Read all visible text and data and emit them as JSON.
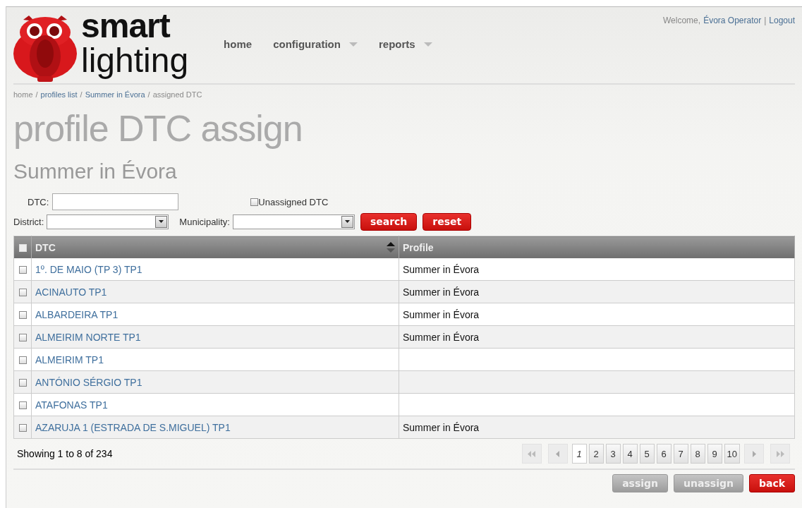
{
  "logo": {
    "line_1": "smart",
    "line_2": "lighting"
  },
  "nav": [
    {
      "label": "home",
      "dropdown": false
    },
    {
      "label": "configuration",
      "dropdown": true
    },
    {
      "label": "reports",
      "dropdown": true
    }
  ],
  "user_bar": {
    "greeting": "Welcome,",
    "user": "Évora Operator",
    "separator": "|",
    "logout": "Logout"
  },
  "breadcrumb": [
    {
      "label": "home",
      "kind": "text"
    },
    {
      "label": "/",
      "kind": "separator"
    },
    {
      "label": "profiles list",
      "kind": "link"
    },
    {
      "label": "/",
      "kind": "separator"
    },
    {
      "label": "Summer in Évora",
      "kind": "link"
    },
    {
      "label": "/",
      "kind": "separator"
    },
    {
      "label": "assigned DTC",
      "kind": "text"
    }
  ],
  "page_title": "profile DTC assign",
  "subtitle": "Summer in Évora",
  "filters": {
    "dtc_label": "DTC:",
    "unassigned_label": "Unassigned DTC",
    "unassigned_checked": false,
    "district_label": "District:",
    "municipality_label": "Municipality:",
    "search_button": "search",
    "reset_button": "reset"
  },
  "table": {
    "select_all_checked": false,
    "columns": [
      "DTC",
      "Profile"
    ],
    "rows": [
      {
        "dtc": "1º. DE MAIO (TP 3) TP1",
        "profile": "Summer in Évora",
        "checked": false
      },
      {
        "dtc": "ACINAUTO TP1",
        "profile": "Summer in Évora",
        "checked": false
      },
      {
        "dtc": "ALBARDEIRA TP1",
        "profile": "Summer in Évora",
        "checked": false
      },
      {
        "dtc": "ALMEIRIM NORTE TP1",
        "profile": "Summer in Évora",
        "checked": false
      },
      {
        "dtc": "ALMEIRIM TP1",
        "checked": false
      },
      {
        "dtc": "ANTÓNIO SÉRGIO TP1",
        "checked": false
      },
      {
        "dtc": "ATAFONAS TP1",
        "checked": false
      },
      {
        "dtc": "AZARUJA 1 (ESTRADA DE S.MIGUEL) TP1",
        "profile": "Summer in Évora",
        "checked": false
      }
    ]
  },
  "footer": {
    "summary": "Showing 1 to 8 of 234",
    "pages": [
      {
        "label": "1",
        "selected": true
      },
      {
        "label": "2",
        "selected": false
      },
      {
        "label": "3",
        "selected": false
      },
      {
        "label": "4",
        "selected": false
      },
      {
        "label": "5",
        "selected": false
      },
      {
        "label": "6",
        "selected": false
      },
      {
        "label": "7",
        "selected": false
      },
      {
        "label": "8",
        "selected": false
      },
      {
        "label": "9",
        "selected": false
      },
      {
        "label": "10",
        "selected": false
      }
    ]
  },
  "actions": [
    {
      "label": "assign",
      "disabled": true
    },
    {
      "label": "unassign",
      "disabled": true
    },
    {
      "label": "back",
      "disabled": false
    }
  ]
}
